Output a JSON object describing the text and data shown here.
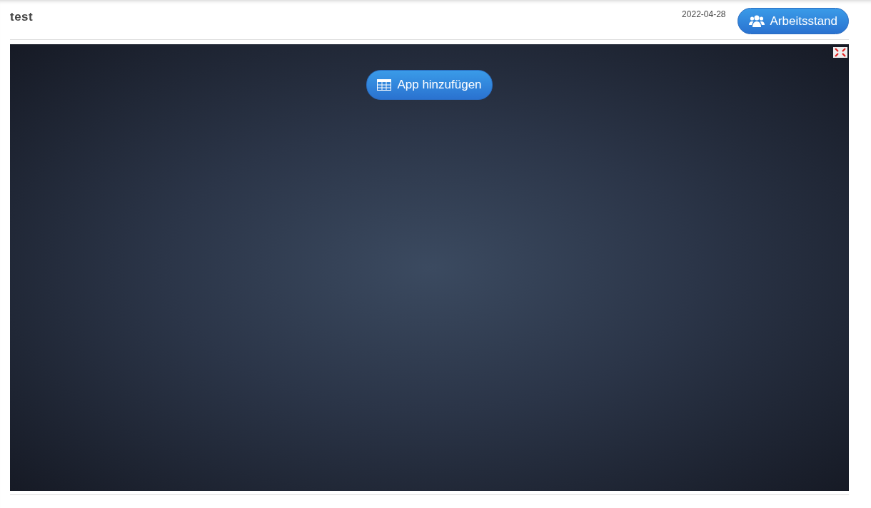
{
  "header": {
    "title": "test",
    "date": "2022-04-28",
    "button": "Arbeitsstand"
  },
  "canvas": {
    "add_button": "App hinzufügen"
  }
}
